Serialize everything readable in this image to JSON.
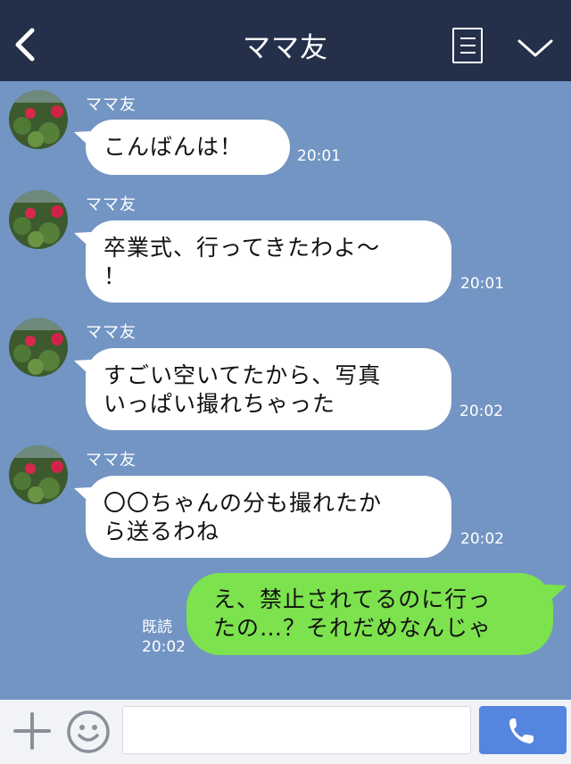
{
  "header": {
    "title": "ママ友",
    "back_icon": "chevron-left-icon",
    "menu_icon": "list-icon",
    "collapse_icon": "chevron-down-icon",
    "bg_color": "#243049"
  },
  "chat": {
    "bg_color": "#7395c3",
    "messages": [
      {
        "sender": "ママ友",
        "text": "こんばんは！",
        "time": "20:01"
      },
      {
        "sender": "ママ友",
        "text": "卒業式、行ってきたわよ〜\n！",
        "time": "20:01"
      },
      {
        "sender": "ママ友",
        "text": "すごい空いてたから、写真\nいっぱい撮れちゃった",
        "time": "20:02"
      },
      {
        "sender": "ママ友",
        "text": "〇〇ちゃんの分も撮れたか\nら送るわね",
        "time": "20:02"
      }
    ],
    "my_message": {
      "text": "え、禁止されてるのに行っ\nたの…？それだめなんじゃ",
      "read_label": "既読",
      "time": "20:02",
      "color": "#7ce24d"
    }
  },
  "footer": {
    "plus_icon": "plus-icon",
    "emoji_icon": "smiley-icon",
    "input_value": "",
    "call_icon": "phone-icon",
    "call_color": "#5586df"
  }
}
